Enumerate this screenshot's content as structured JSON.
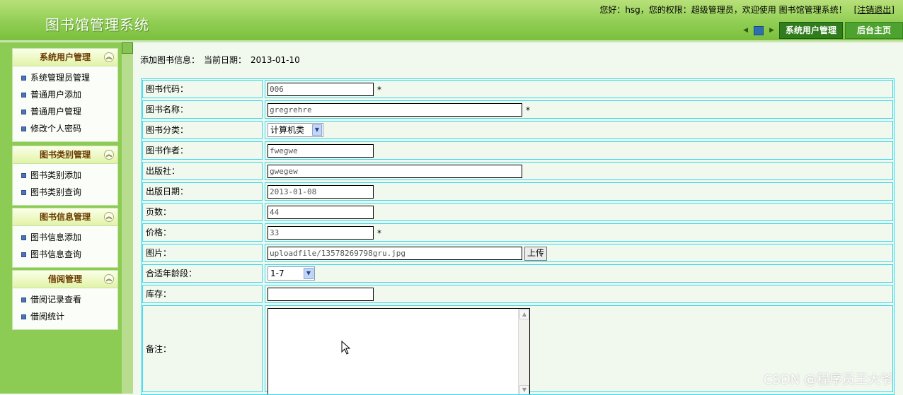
{
  "header": {
    "title": "图书馆管理系统",
    "welcome": "您好：hsg，您的权限：超级管理员，欢迎使用 图书馆管理系统！",
    "logout": "[注销退出]",
    "btn_user_mgmt": "系统用户管理",
    "btn_home": "后台主页"
  },
  "sidebar": {
    "groups": [
      {
        "title": "系统用户管理",
        "items": [
          "系统管理员管理",
          "普通用户添加",
          "普通用户管理",
          "修改个人密码"
        ]
      },
      {
        "title": "图书类别管理",
        "items": [
          "图书类别添加",
          "图书类别查询"
        ]
      },
      {
        "title": "图书信息管理",
        "items": [
          "图书信息添加",
          "图书信息查询"
        ]
      },
      {
        "title": "借阅管理",
        "items": [
          "借阅记录查看",
          "借阅统计"
        ]
      }
    ]
  },
  "main": {
    "crumb_label": "添加图书信息：",
    "date_label": "当前日期：",
    "date_value": "2013-01-10"
  },
  "form": {
    "book_code": {
      "label": "图书代码：",
      "value": "006",
      "required": "*"
    },
    "book_name": {
      "label": "图书名称：",
      "value": "gregrehre",
      "required": "*"
    },
    "category": {
      "label": "图书分类：",
      "value": "计算机类"
    },
    "author": {
      "label": "图书作者：",
      "value": "fwegwe"
    },
    "publisher": {
      "label": "出版社：",
      "value": "gwegew"
    },
    "pub_date": {
      "label": "出版日期：",
      "value": "2013-01-08"
    },
    "pages": {
      "label": "页数：",
      "value": "44"
    },
    "price": {
      "label": "价格：",
      "value": "33",
      "required": "*"
    },
    "image": {
      "label": "图片：",
      "value": "uploadfile/13578269798gru.jpg",
      "upload": "上传"
    },
    "age_range": {
      "label": "合适年龄段：",
      "value": "1-7"
    },
    "stock": {
      "label": "库存：",
      "value": ""
    },
    "remark": {
      "label": "备注：",
      "value": ""
    }
  },
  "watermark": "CSDN @程序员王大爷"
}
